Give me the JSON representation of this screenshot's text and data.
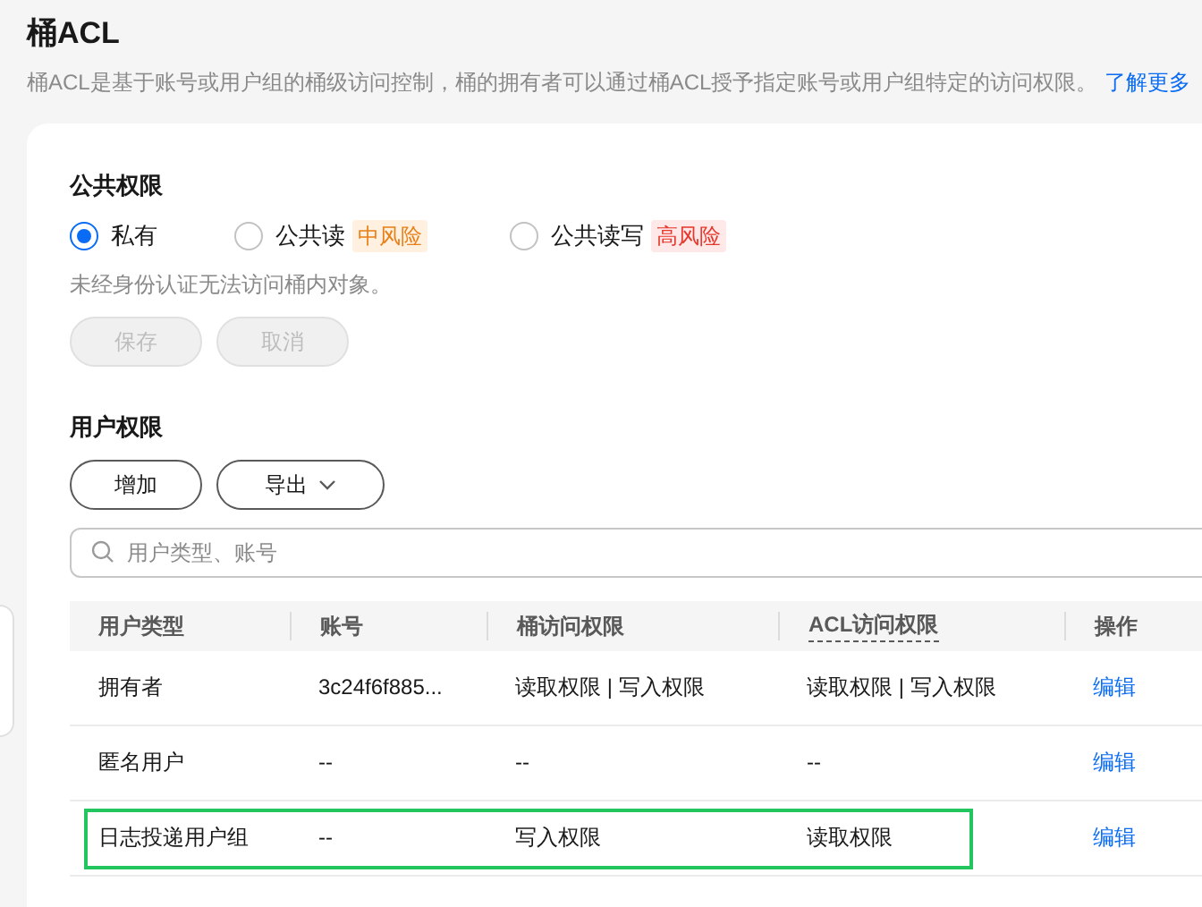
{
  "title": "桶ACL",
  "description": "桶ACL是基于账号或用户组的桶级访问控制，桶的拥有者可以通过桶ACL授予指定账号或用户组特定的访问权限。",
  "learn_more_link": "了解更多",
  "public_permissions": {
    "heading": "公共权限",
    "options": [
      {
        "label": "私有",
        "selected": true
      },
      {
        "label": "公共读",
        "selected": false,
        "risk": {
          "label": "中风险",
          "kind": "medium"
        }
      },
      {
        "label": "公共读写",
        "selected": false,
        "risk": {
          "label": "高风险",
          "kind": "high"
        }
      }
    ],
    "hint": "未经身份认证无法访问桶内对象。",
    "buttons": [
      {
        "label": "保存",
        "disabled": true
      },
      {
        "label": "取消",
        "disabled": true
      }
    ]
  },
  "user_permissions": {
    "heading": "用户权限",
    "buttons": [
      {
        "label": "增加",
        "kind": "plain"
      },
      {
        "label": "导出",
        "kind": "dropdown"
      }
    ],
    "search": {
      "placeholder": "用户类型、账号"
    },
    "table": {
      "columns": [
        {
          "label": "用户类型",
          "dashed": false
        },
        {
          "label": "账号",
          "dashed": false
        },
        {
          "label": "桶访问权限",
          "dashed": false
        },
        {
          "label": "ACL访问权限",
          "dashed": true
        },
        {
          "label": "操作",
          "dashed": false
        }
      ],
      "rows": [
        {
          "user_type": "拥有者",
          "account": "3c24f6f885...",
          "bucket_access": "读取权限 | 写入权限",
          "acl_access": "读取权限 | 写入权限",
          "action": "编辑",
          "highlighted": false
        },
        {
          "user_type": "匿名用户",
          "account": "--",
          "bucket_access": "--",
          "acl_access": "--",
          "action": "编辑",
          "highlighted": false
        },
        {
          "user_type": "日志投递用户组",
          "account": "--",
          "bucket_access": "写入权限",
          "acl_access": "读取权限",
          "action": "编辑",
          "highlighted": true
        }
      ]
    }
  }
}
